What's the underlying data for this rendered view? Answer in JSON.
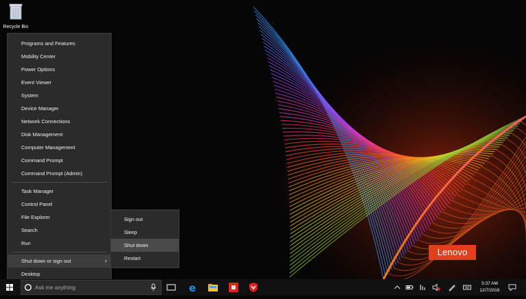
{
  "desktop": {
    "recycle_bin_label": "Recycle Bin",
    "brand": "Lenovo"
  },
  "winx_menu": {
    "items": [
      "Programs and Features",
      "Mobility Center",
      "Power Options",
      "Event Viewer",
      "System",
      "Device Manager",
      "Network Connections",
      "Disk Management",
      "Computer Management",
      "Command Prompt",
      "Command Prompt (Admin)",
      "Task Manager",
      "Control Panel",
      "File Explorer",
      "Search",
      "Run",
      "Shut down or sign out",
      "Desktop"
    ],
    "highlighted": "Shut down or sign out"
  },
  "shutdown_submenu": {
    "items": [
      "Sign out",
      "Sleep",
      "Shut down",
      "Restart"
    ],
    "highlighted": "Shut down"
  },
  "taskbar": {
    "search_placeholder": "Ask me anything",
    "pinned": [
      "task-view-icon",
      "edge-icon",
      "file-explorer-icon",
      "store-icon",
      "security-shield-icon"
    ],
    "time": "5:37 AM",
    "date": "12/7/2016"
  },
  "colors": {
    "menu_bg": "#2b2b2b",
    "taskbar_bg": "#101010",
    "lenovo_red": "#e2401c",
    "edge_blue": "#1e90e0"
  }
}
